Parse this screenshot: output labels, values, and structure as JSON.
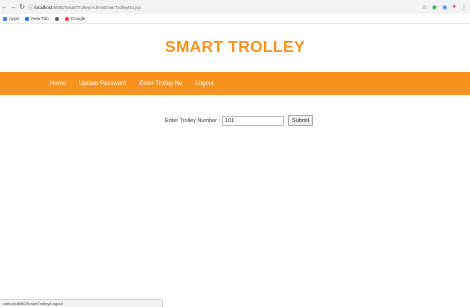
{
  "browser": {
    "url_host": "localhost",
    "url_path": ":8080/SmartTrolley/AdminEnterTrolleyNo.jsp",
    "bookmarks": [
      {
        "label": "Apps",
        "icon_color": "#4285f4"
      },
      {
        "label": "New Tab",
        "icon_color": "#1a73e8"
      },
      {
        "label": "",
        "icon_color": "#5f6368"
      },
      {
        "label": "Google",
        "icon_color": "#ea4335"
      }
    ]
  },
  "header": {
    "brand": "SMART TROLLEY",
    "brand_color": "#f7931e"
  },
  "nav": {
    "color": "#f7931e",
    "items": [
      "Home",
      "Update Password",
      "Enter Trolley No",
      "Logout"
    ]
  },
  "form": {
    "label": "Enter Trolley Number :",
    "value": "101",
    "submit_label": "Submit"
  },
  "status_bar": {
    "text": "calhost:8080/SmartTrolley/Logout"
  }
}
